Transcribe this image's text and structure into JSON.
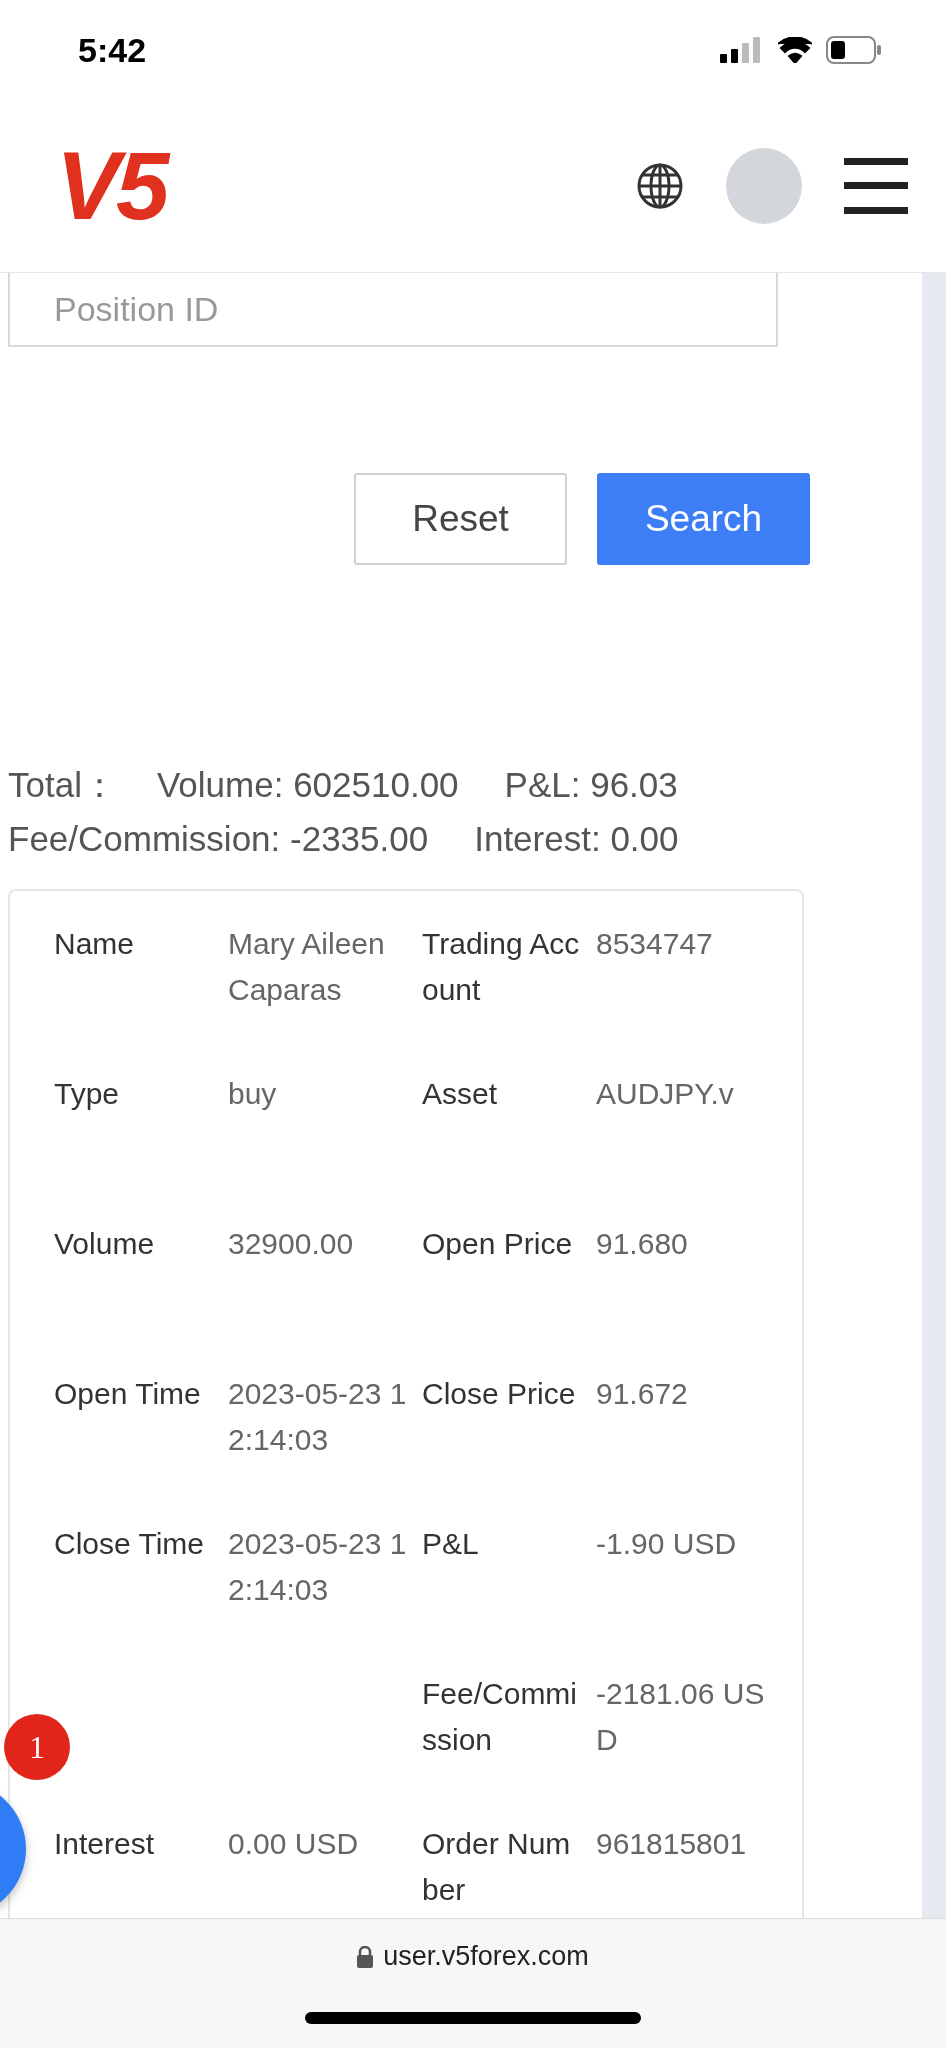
{
  "status_bar": {
    "time": "5:42"
  },
  "header": {
    "logo_text": "V5"
  },
  "filter": {
    "position_id": {
      "placeholder": "Position ID"
    },
    "buttons": [
      {
        "label": "Reset",
        "kind": "secondary"
      },
      {
        "label": "Search",
        "kind": "primary"
      }
    ]
  },
  "totals": {
    "title": "Total：",
    "items": [
      "Volume: 602510.00",
      "P&L: 96.03",
      "Fee/Commission: -2335.00",
      "Interest: 0.00"
    ]
  },
  "record": {
    "rows": [
      {
        "left": {
          "label": "Name",
          "value": "Mary Aileen Caparas"
        },
        "right": {
          "label": "Trading Account",
          "value": "8534747"
        }
      },
      {
        "left": {
          "label": "Type",
          "value": "buy"
        },
        "right": {
          "label": "Asset",
          "value": "AUDJPY.v"
        }
      },
      {
        "left": {
          "label": "Volume",
          "value": "32900.00"
        },
        "right": {
          "label": "Open Price",
          "value": "91.680"
        }
      },
      {
        "left": {
          "label": "Open Time",
          "value": "2023-05-23 12:14:03"
        },
        "right": {
          "label": "Close Price",
          "value": "91.672"
        }
      },
      {
        "left": {
          "label": "Close Time",
          "value": "2023-05-23 12:14:03"
        },
        "right": {
          "label": "P&L",
          "value": "-1.90 USD"
        }
      },
      {
        "right": {
          "label": "Fee/Commission",
          "value": "-2181.06 USD"
        }
      },
      {
        "left": {
          "label": "Interest",
          "value": "0.00 USD"
        },
        "right": {
          "label": "Order Number",
          "value": "961815801"
        }
      }
    ]
  },
  "float_button": {
    "badge": "1"
  },
  "address_bar": {
    "url": "user.v5forex.com",
    "secure": true
  }
}
